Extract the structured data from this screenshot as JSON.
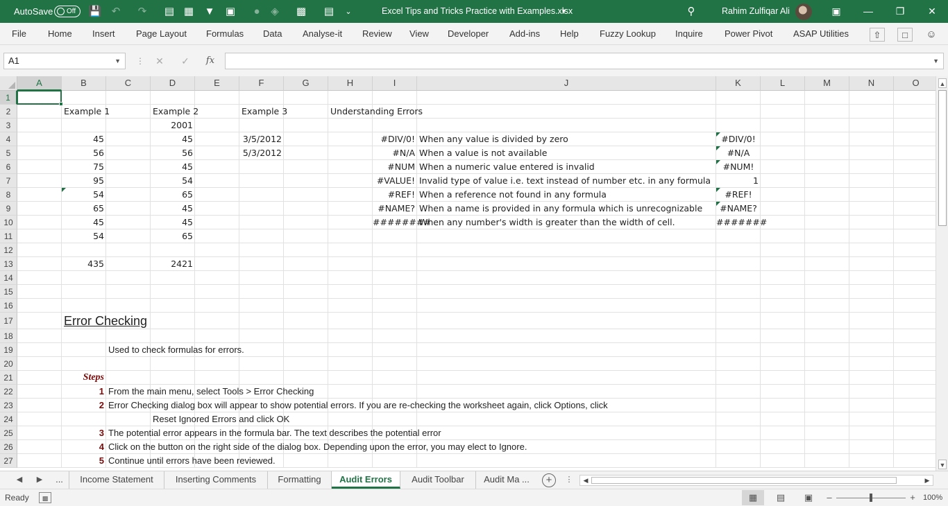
{
  "titlebar": {
    "autosave_label": "AutoSave",
    "autosave_state": "Off",
    "doc_title": "Excel Tips and Tricks Practice with Examples.xlsx",
    "user_name": "Rahim Zulfiqar Ali"
  },
  "menu": [
    "File",
    "Home",
    "Insert",
    "Page Layout",
    "Formulas",
    "Data",
    "Analyse-it",
    "Review",
    "View",
    "Developer",
    "Add-ins",
    "Help",
    "Fuzzy Lookup",
    "Inquire",
    "Power Pivot",
    "ASAP Utilities"
  ],
  "formula_bar": {
    "name_box": "A1",
    "formula": ""
  },
  "columns": [
    "A",
    "B",
    "C",
    "D",
    "E",
    "F",
    "G",
    "H",
    "I",
    "J",
    "K",
    "L",
    "M",
    "N",
    "O"
  ],
  "rows": [
    "1",
    "2",
    "3",
    "4",
    "5",
    "6",
    "7",
    "8",
    "9",
    "10",
    "11",
    "12",
    "13",
    "14",
    "15",
    "16",
    "17",
    "18",
    "19",
    "20",
    "21",
    "22",
    "23",
    "24",
    "25",
    "26",
    "27"
  ],
  "cells": {
    "B2": "Example 1",
    "D2": "Example 2",
    "F2": "Example 3",
    "H2": "Understanding Errors",
    "D3": "2001",
    "B4": "45",
    "D4": "45",
    "F4": "3/5/2012",
    "I4": "#DIV/0!",
    "J4": "When any value is divided by zero",
    "K4": "#DIV/0!",
    "B5": "56",
    "D5": "56",
    "F5": "5/3/2012",
    "I5": "#N/A",
    "J5": "When a value is not available",
    "K5": "#N/A",
    "B6": "75",
    "D6": "45",
    "I6": "#NUM",
    "J6": "When a numeric value entered is invalid",
    "K6": "#NUM!",
    "B7": "95",
    "D7": "54",
    "I7": "#VALUE!",
    "J7": "Invalid type of value i.e. text instead of number etc. in any formula",
    "K7": "1",
    "B8": "54",
    "D8": "65",
    "I8": "#REF!",
    "J8": "When a reference not found in any formula",
    "K8": "#REF!",
    "B9": "65",
    "D9": "45",
    "I9": "#NAME?",
    "J9": "When a name is provided in any formula which is unrecognizable",
    "K9": "#NAME?",
    "B10": "45",
    "D10": "45",
    "I10": "########",
    "J10": "When any number's width is greater than the width of cell.",
    "K10": "#######",
    "B11": "54",
    "D11": "65",
    "B13": "435",
    "D13": "2421",
    "B17": "Error Checking",
    "C19": "Used to check formulas for errors.",
    "B21": "Steps",
    "B22": "1",
    "C22": "From the main menu, select Tools > Error Checking",
    "B23": "2",
    "C23": "Error Checking dialog box will appear to show potential errors. If you are re-checking the worksheet again, click Options, click",
    "D24": "Reset Ignored Errors and click OK",
    "B25": "3",
    "C25": "The potential error appears in the formula bar. The text describes the potential error",
    "B26": "4",
    "C26": "Click on the button on the right side of the dialog box. Depending upon the error, you may elect to Ignore.",
    "B27": "5",
    "C27": "Continue until errors have been reviewed."
  },
  "sheet_tabs": [
    "...",
    "Income Statement",
    "Inserting Comments",
    "Formatting",
    "Audit Errors",
    "Audit Toolbar",
    "Audit Ma ..."
  ],
  "active_sheet": "Audit Errors",
  "status": {
    "ready": "Ready",
    "zoom": "100%"
  },
  "colors": {
    "excel_green": "#217346",
    "step_red": "#7a0a0a"
  }
}
